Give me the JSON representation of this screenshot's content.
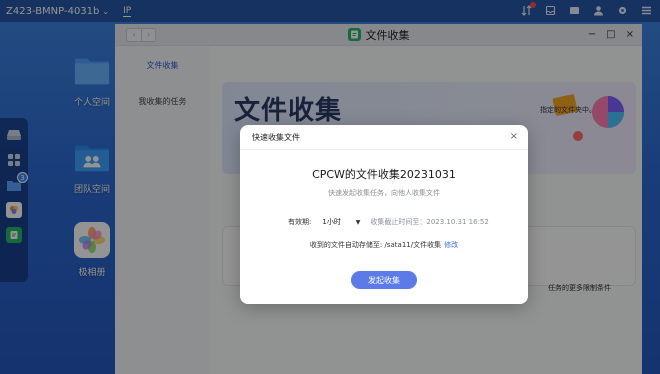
{
  "topbar": {
    "device_name": "Z423-BMNP-4031b",
    "ip_label": "IP",
    "icons": [
      "sort-icon",
      "notification-icon",
      "message-icon",
      "user-icon",
      "settings-icon",
      "menu-icon"
    ]
  },
  "dock": {
    "items": [
      "hdd-icon",
      "apps-grid-icon",
      "folder-icon",
      "photos-small-icon",
      "file-collect-small-icon"
    ],
    "folder_badge": "3"
  },
  "desktop_apps": [
    {
      "label": "个人空间",
      "icon": "personal-folder-icon"
    },
    {
      "label": "团队空间",
      "icon": "team-folder-icon"
    },
    {
      "label": "极相册",
      "icon": "photo-album-icon"
    }
  ],
  "window": {
    "title": "文件收集",
    "nav_back": "‹",
    "nav_forward": "›",
    "controls": {
      "minimize": "−",
      "maximize": "□",
      "close": "×"
    }
  },
  "sidebar": {
    "items": [
      {
        "label": "文件收集",
        "active": true
      },
      {
        "label": "我收集的任务",
        "active": false
      }
    ]
  },
  "banner": {
    "title": "文件收集",
    "desc_fragment": "指定的文件夹中。"
  },
  "card2": {
    "text_fragment": "任务的更多限制条件"
  },
  "modal": {
    "title": "快速收集文件",
    "close": "×",
    "heading": "CPCW的文件收集20231031",
    "subtitle": "快速发起收集任务，向他人收集文件",
    "validity_label": "有效期:",
    "validity_value": "1小时",
    "deadline_text": "收集截止时间至：2023.10.31 16:52",
    "save_path_text": "收到的文件自动存储至: /sata11/文件收集",
    "edit_link": "修改",
    "start_button": "发起收集"
  }
}
